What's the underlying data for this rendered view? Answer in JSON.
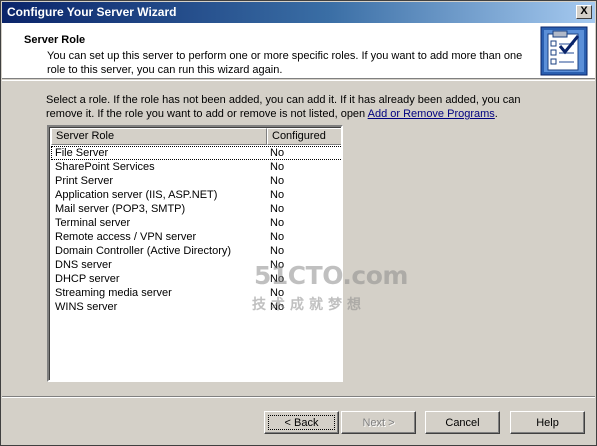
{
  "window": {
    "title": "Configure Your Server Wizard",
    "close_label": "X"
  },
  "header": {
    "title": "Server Role",
    "description": "You can set up this server to perform one or more specific roles. If you want to add more than one role to this server, you can run this wizard again.",
    "icon": "wizard-checklist-icon"
  },
  "instructions": {
    "text": "Select a role. If the role has not been added, you can add it. If it has already been added, you can remove it. If the role you want to add or remove is not listed, open ",
    "link": "Add or Remove Programs",
    "suffix": "."
  },
  "roles_list": {
    "columns": [
      "Server Role",
      "Configured"
    ],
    "rows": [
      {
        "role": "File Server",
        "configured": "No"
      },
      {
        "role": "SharePoint Services",
        "configured": "No"
      },
      {
        "role": "Print Server",
        "configured": "No"
      },
      {
        "role": "Application server (IIS, ASP.NET)",
        "configured": "No"
      },
      {
        "role": "Mail server (POP3, SMTP)",
        "configured": "No"
      },
      {
        "role": "Terminal server",
        "configured": "No"
      },
      {
        "role": "Remote access / VPN server",
        "configured": "No"
      },
      {
        "role": "Domain Controller (Active Directory)",
        "configured": "No"
      },
      {
        "role": "DNS server",
        "configured": "No"
      },
      {
        "role": "DHCP server",
        "configured": "No"
      },
      {
        "role": "Streaming media server",
        "configured": "No"
      },
      {
        "role": "WINS server",
        "configured": "No"
      }
    ]
  },
  "watermark": {
    "logo": "51CTO.com",
    "tagline": "技术成就梦想"
  },
  "buttons": {
    "back": "< Back",
    "next": "Next >",
    "cancel": "Cancel",
    "help": "Help"
  },
  "colors": {
    "title_bar_start": "#0a246a",
    "title_bar_end": "#a6caf0",
    "dialog_face": "#d4d0c8",
    "link": "#000080"
  }
}
